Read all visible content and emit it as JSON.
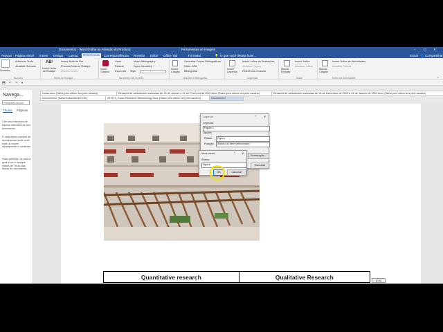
{
  "window": {
    "title": "Documento1 - Word (Falha na Ativação do Produto)",
    "context_tab": "Ferramentas de Imagem",
    "search_placeholder": "O que você deseja fazer..."
  },
  "menu": {
    "items": [
      "Arquivo",
      "Página Inicial",
      "Inserir",
      "Design",
      "Layout",
      "Referências",
      "Correspondências",
      "Revisão",
      "Exibir",
      "Office Tab",
      "Formatar"
    ],
    "right": [
      "Entrar",
      "Compartilhar"
    ]
  },
  "ribbon": {
    "sumario": {
      "big": "Sumário",
      "items": [
        "Adicionar Texto",
        "Atualizar Sumário"
      ],
      "group": "Sumário"
    },
    "notas": {
      "big1": "Inserir Nota de Rodapé",
      "items": [
        "Inserir Nota de Fim",
        "Próxima Nota de Rodapé",
        "Mostrar Notas"
      ],
      "group": "Notas de Rodapé"
    },
    "mendeley": {
      "big": "Insert Citation",
      "items": [
        "Undo",
        "Refresh",
        "Export as",
        "Insert Bibliography",
        "Open Mendeley",
        "Style"
      ],
      "group": "Mendeley Cite-O-Matic"
    },
    "citacoes": {
      "big": "Inserir Citação",
      "items": [
        "Gerenciar Fontes Bibliográficas",
        "Estilo: APA",
        "Bibliografia"
      ],
      "group": "Citações e Bibliografia"
    },
    "legendas": {
      "big": "Inserir Legenda",
      "items": [
        "Inserir Índice de Ilustrações",
        "Atualizar Tabela",
        "Referência Cruzada"
      ],
      "group": "Legendas"
    },
    "indice": {
      "big": "Marcar Entrada",
      "items": [
        "Inserir Índice",
        "Atualizar Índice"
      ],
      "group": "Índice"
    },
    "autoridades": {
      "big": "Marcar Citação",
      "items": [
        "Inserir Índice de Autoridades",
        "Atualizar Tabela"
      ],
      "group": "Índice de Autoridades"
    }
  },
  "doc_tabs": {
    "row1": [
      "Notas.docx (Salvo pelo último vez pelo usuário)",
      "Relatório de actividades realizadas de 15 de Janeiro a 12 de Fevereiro de 2021.docx (Salvo pelo último vez pelo usuário)",
      "Relatório de actividades realizadas de 16 de Dezembro de 2020 a 15 de Janeiro de 2021.docx (Salvo pelo último vez pelo usuário)"
    ],
    "row2": [
      "Documento2 (Salvo Automaticamente)",
      "297573_Guion Research Methodology.docx (Salvo pelo último vez pelo usuário)",
      "Documento1"
    ]
  },
  "nav": {
    "title": "Navega...",
    "search_placeholder": "Pesquisar docum",
    "tabs": [
      "Títulos",
      "Páginas"
    ],
    "text1": "Crie uma estrutura de tópicos interativa de seu documento.",
    "text2": "É uma ótima maneira de acompanhar onde você está ou mover rapidamente o conteúdo.",
    "text3": "Para começar, vá para a guia Início e aplique estilos de Título aos títulos do documento."
  },
  "legenda_dialog": {
    "title": "Legenda",
    "legenda_label": "Legenda:",
    "legenda_value": "Figura 1",
    "opcoes_label": "Opções",
    "rotulo_label": "Rótulo:",
    "rotulo_value": "Figura",
    "posicao_label": "Posição:",
    "posicao_value": "Abaixo do item selecionado",
    "numeracao_button": "Numeração...",
    "cancel_button": "Cancelar"
  },
  "novo_nome_dialog": {
    "title": "Novo nome",
    "rotulo_label": "Rótulo:",
    "rotulo_value": "Figura",
    "ok_button": "OK",
    "cancel_button": "Cancelar"
  },
  "table": {
    "headers": [
      "Quantitative research",
      "Qualitative Research"
    ]
  },
  "paste_badge": "(Ctrl)"
}
